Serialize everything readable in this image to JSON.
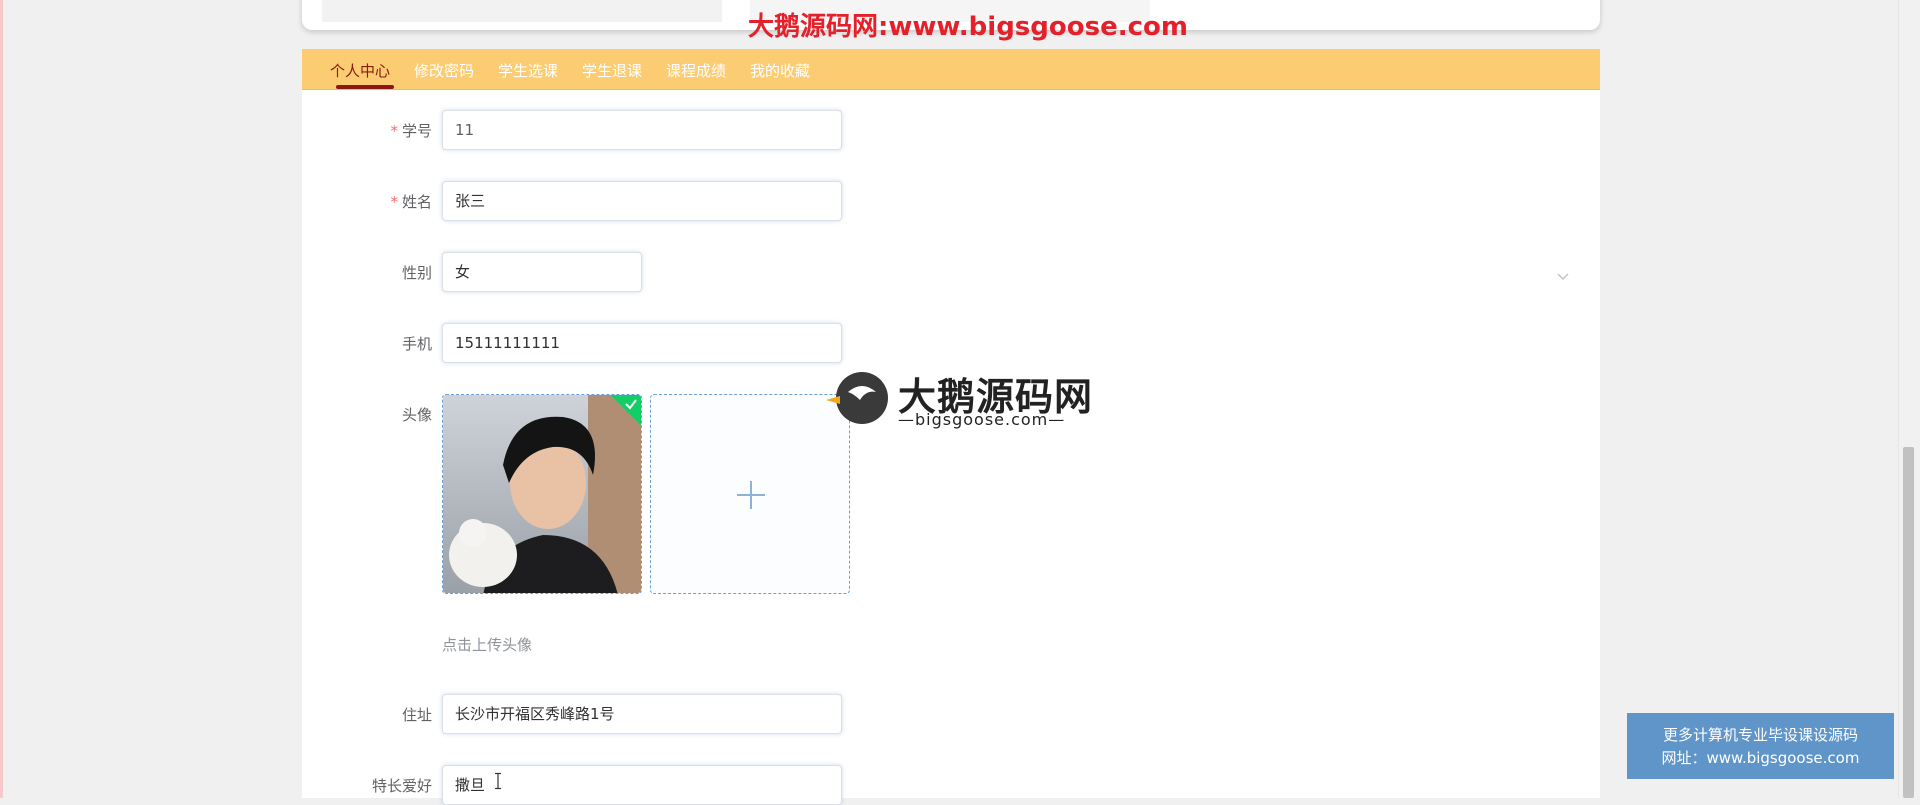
{
  "watermark": {
    "top_text": "大鹅源码网:www.bigsgoose.com",
    "logo_title": "大鹅源码网",
    "logo_sub": "—bigsgoose.com—"
  },
  "nav": {
    "items": [
      {
        "label": "个人中心",
        "active": true
      },
      {
        "label": "修改密码",
        "active": false
      },
      {
        "label": "学生选课",
        "active": false
      },
      {
        "label": "学生退课",
        "active": false
      },
      {
        "label": "课程成绩",
        "active": false
      },
      {
        "label": "我的收藏",
        "active": false
      }
    ]
  },
  "form": {
    "required_mark": "*",
    "student_id": {
      "label": "学号",
      "value": "11"
    },
    "name": {
      "label": "姓名",
      "value": "张三"
    },
    "gender": {
      "label": "性别",
      "value": "女"
    },
    "phone": {
      "label": "手机",
      "value": "15111111111"
    },
    "avatar": {
      "label": "头像",
      "hint": "点击上传头像",
      "plus_icon": "plus-icon",
      "uploaded_icon": "check-icon"
    },
    "address": {
      "label": "住址",
      "value": "长沙市开福区秀峰路1号"
    },
    "hobby": {
      "label": "特长爱好",
      "value": "撒旦"
    }
  },
  "promo": {
    "line1": "更多计算机专业毕设课设源码",
    "line2": "网址：www.bigsgoose.com"
  },
  "colors": {
    "nav_bg": "#fccc72",
    "nav_active": "#8a1a10",
    "required": "#f56c6c",
    "watermark": "#e5202a",
    "promo_bg": "#5f95c9",
    "upload_border": "#6aa0d8",
    "success": "#13ce66"
  }
}
